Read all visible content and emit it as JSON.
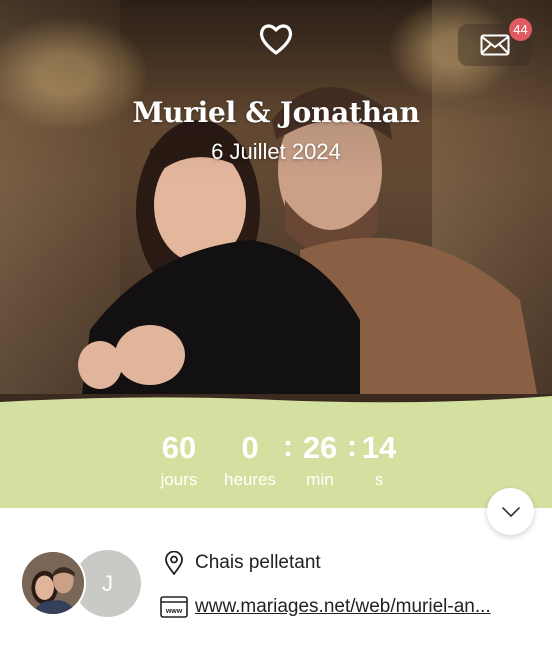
{
  "header": {
    "couple_names": "Muriel & Jonathan",
    "wedding_date": "6 Juillet 2024",
    "icons": {
      "top": "heart-icon",
      "messages": "envelope-icon"
    },
    "unread_count": "44"
  },
  "countdown": {
    "items": [
      {
        "value": "60",
        "label": "jours"
      },
      {
        "value": "0",
        "label": "heures"
      },
      {
        "value": "26",
        "label": "min"
      },
      {
        "value": "14",
        "label": "s"
      }
    ],
    "separator": ":",
    "band_color": "#d4e09f"
  },
  "info": {
    "avatar_initial": "J",
    "place": "Chais pelletant",
    "website": "www.mariages.net/web/muriel-an...",
    "icons": {
      "place": "map-pin-icon",
      "website": "www-icon"
    }
  },
  "colors": {
    "badge": "#e05a63",
    "accent": "#d4e09f"
  }
}
